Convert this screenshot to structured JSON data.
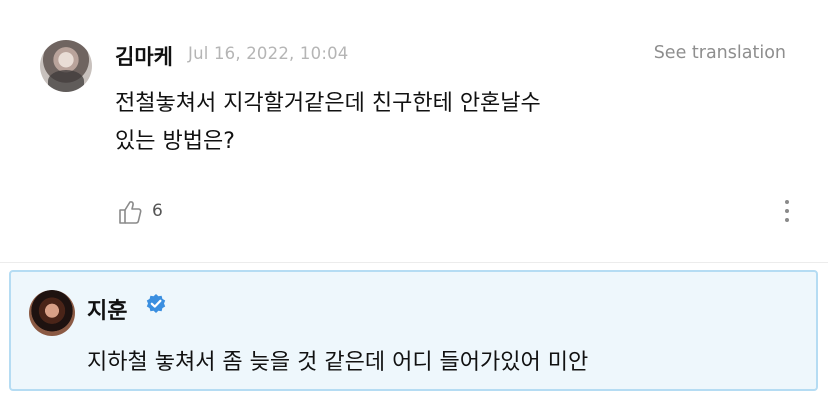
{
  "comment": {
    "author": "김마케",
    "timestamp": "Jul 16, 2022, 10:04",
    "translate_label": "See translation",
    "text_line1": "전철놓쳐서 지각할거같은데 친구한테 안혼날수",
    "text_line2": "있는 방법은?",
    "like_count": "6"
  },
  "reply": {
    "author": "지훈",
    "text": "지하철 놓쳐서 좀 늦을 것 같은데 어디 들어가있어 미안",
    "verified": true
  },
  "colors": {
    "reply_background": "#eef7fc",
    "reply_border": "#b5dcf3",
    "verified_badge": "#3b8fe0"
  }
}
